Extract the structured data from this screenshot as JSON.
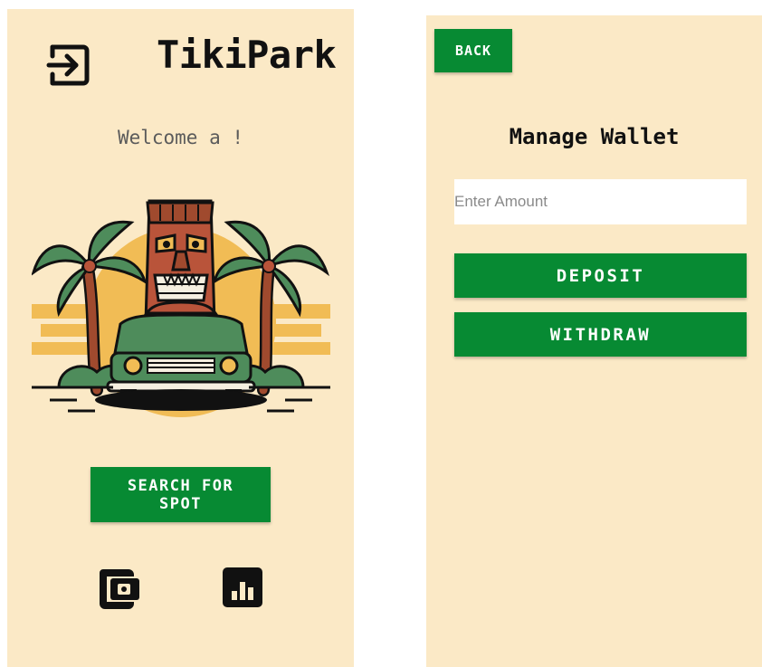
{
  "home": {
    "app_title": "TikiPark",
    "welcome_text": "Welcome a !",
    "search_button_label": "SEARCH FOR SPOT",
    "icons": {
      "logout": "logout-icon",
      "wallet": "wallet-icon",
      "stats": "bar-chart-icon"
    }
  },
  "wallet": {
    "back_label": "BACK",
    "title": "Manage Wallet",
    "amount_placeholder": "Enter Amount",
    "amount_value": "",
    "deposit_label": "DEPOSIT",
    "withdraw_label": "WITHDRAW"
  },
  "colors": {
    "background": "#fbe9c6",
    "primary": "#078a33",
    "text": "#111111"
  }
}
